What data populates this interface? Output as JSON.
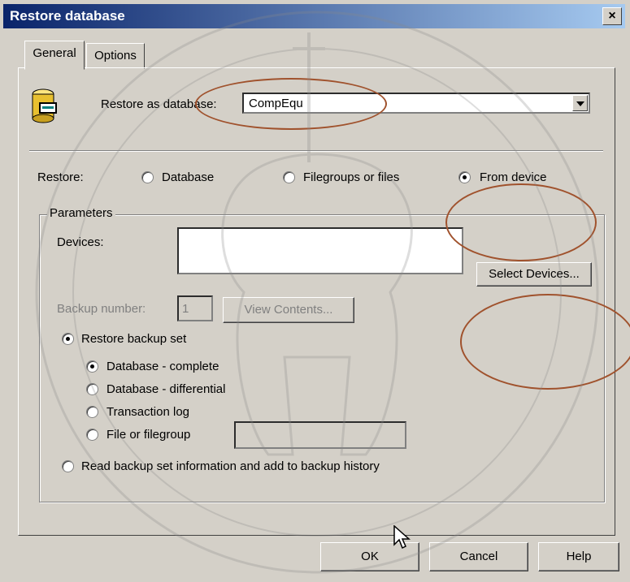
{
  "window": {
    "title": "Restore database",
    "close_glyph": "×"
  },
  "tabs": [
    {
      "label": "General",
      "active": true
    },
    {
      "label": "Options",
      "active": false
    }
  ],
  "restore_as": {
    "label": "Restore as database:",
    "value": "CompEqu"
  },
  "restore": {
    "label": "Restore:",
    "options": [
      {
        "label": "Database",
        "selected": false
      },
      {
        "label": "Filegroups or files",
        "selected": false
      },
      {
        "label": "From device",
        "selected": true
      }
    ]
  },
  "parameters": {
    "legend": "Parameters",
    "devices_label": "Devices:",
    "select_devices_label": "Select Devices...",
    "backup_number_label": "Backup number:",
    "backup_number_value": "1",
    "view_contents_label": "View Contents...",
    "restore_backup_set_label": "Restore backup set",
    "backup_types": [
      {
        "label": "Database - complete",
        "selected": true
      },
      {
        "label": "Database - differential",
        "selected": false
      },
      {
        "label": "Transaction log",
        "selected": false
      },
      {
        "label": "File or filegroup",
        "selected": false
      }
    ],
    "read_info_label": "Read backup set information and add to backup history"
  },
  "footer": {
    "ok_label": "OK",
    "cancel_label": "Cancel",
    "help_label": "Help"
  },
  "annotation_color": "#a0522d"
}
